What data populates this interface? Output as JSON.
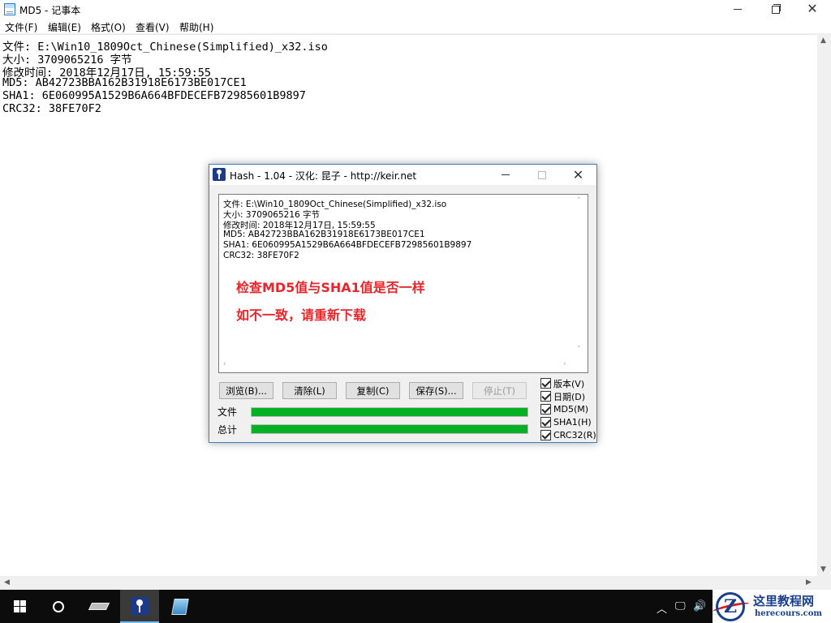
{
  "notepad": {
    "title": "MD5 - 记事本",
    "menus": [
      "文件(F)",
      "编辑(E)",
      "格式(O)",
      "查看(V)",
      "帮助(H)"
    ],
    "lines": [
      "文件: E:\\Win10_1809Oct_Chinese(Simplified)_x32.iso",
      "大小: 3709065216 字节",
      "修改时间: 2018年12月17日, 15:59:55",
      "MD5: AB42723BBA162B31918E6173BE017CE1",
      "SHA1: 6E060995A1529B6A664BFDECEFB72985601B9897",
      "CRC32: 38FE70F2"
    ]
  },
  "hash": {
    "title": "Hash - 1.04 - 汉化: 昆子 - http://keir.net",
    "output_lines": [
      "文件: E:\\Win10_1809Oct_Chinese(Simplified)_x32.iso",
      "大小: 3709065216 字节",
      "修改时间: 2018年12月17日, 15:59:55",
      "MD5: AB42723BBA162B31918E6173BE017CE1",
      "SHA1: 6E060995A1529B6A664BFDECEFB72985601B9897",
      "CRC32: 38FE70F2"
    ],
    "notes": [
      "检查MD5值与SHA1值是否一样",
      "如不一致，请重新下载"
    ],
    "buttons": {
      "browse": "浏览(B)...",
      "clear": "清除(L)",
      "copy": "复制(C)",
      "save": "保存(S)...",
      "stop": "停止(T)"
    },
    "checkboxes": [
      {
        "label": "版本(V)",
        "checked": true
      },
      {
        "label": "日期(D)",
        "checked": true
      },
      {
        "label": "MD5(M)",
        "checked": true
      },
      {
        "label": "SHA1(H)",
        "checked": true
      },
      {
        "label": "CRC32(R)",
        "checked": true
      }
    ],
    "progress": {
      "file_label": "文件",
      "total_label": "总计",
      "file_percent": 100,
      "total_percent": 100,
      "color": "#06b025"
    }
  },
  "watermark": {
    "letter": "Z",
    "site_name": "这里教程网",
    "url": "herecours.com"
  },
  "colors": {
    "note_red": "#e8262b",
    "accent_blue": "#3c7fc4",
    "taskbar": "#0c0c0c"
  }
}
